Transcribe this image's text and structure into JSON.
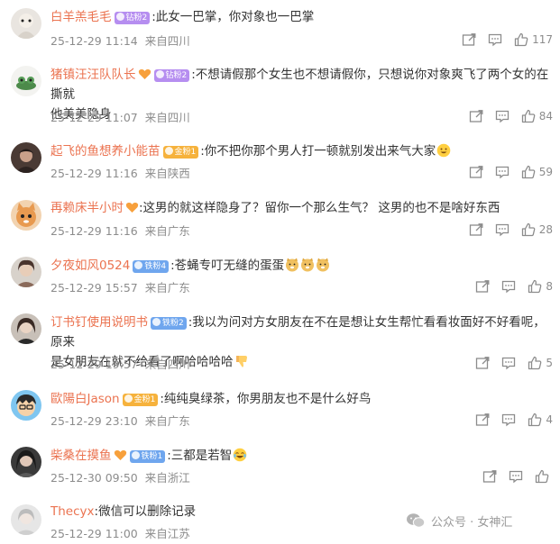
{
  "comments": [
    {
      "user": "白羊羔毛毛",
      "badge": "钻粉2",
      "text": ":此女一巴掌，你对象也一巴掌",
      "time": "25-12-29 11:14",
      "loc": "来自四川",
      "likes": "117"
    },
    {
      "user": "猪镇汪汪队队长",
      "badge": "钻粉2",
      "text": ":不想请假那个女生也不想请假你，只想说你对象爽飞了两个女的在撕就他美美隐身",
      "text1": ":不想请假那个女生也不想请假你，只想说你对象爽飞了两个女的在撕就",
      "text2": "他美美隐身",
      "time": "25-12-29 11:07",
      "loc": "来自四川",
      "likes": "84"
    },
    {
      "user": "起飞的鱼想养小能苗",
      "badge": "金粉1",
      "text": ":你不把你那个男人打一顿就别发出来气大家",
      "time": "25-12-29 11:16",
      "loc": "来自陕西",
      "likes": "59"
    },
    {
      "user": "再赖床半小时",
      "badge": "",
      "text": ":这男的就这样隐身了？留你一个那么生气？ 这男的也不是啥好东西",
      "time": "25-12-29 11:16",
      "loc": "来自广东",
      "likes": "28"
    },
    {
      "user": "夕夜如风0524",
      "badge": "铁粉4",
      "text": ":苍蝇专叮无缝的蛋蛋",
      "time": "25-12-29 15:57",
      "loc": "来自广东",
      "likes": "8"
    },
    {
      "user": "订书钉使用说明书",
      "badge": "铁粉2",
      "text": ":我以为问对方女朋友在不在是想让女生帮忙看看妆面好不好看呢，原来是女朋友在就不给看了啊哈哈哈哈",
      "text1": ":我以为问对方女朋友在不在是想让女生帮忙看看妆面好不好看呢，原来",
      "text2": "是女朋友在就不给看了啊哈哈哈哈",
      "time": "25-12-29 19:57",
      "loc": "来自四川",
      "likes": "5"
    },
    {
      "user": "歐陽白Jason",
      "badge": "金粉1",
      "text": ":纯纯臭绿茶，你男朋友也不是什么好鸟",
      "time": "25-12-29 23:10",
      "loc": "来自广东",
      "likes": "4"
    },
    {
      "user": "柴桑在摸鱼",
      "badge": "铁粉1",
      "text": ":三都是若智",
      "time": "25-12-30 09:50",
      "loc": "来自浙江",
      "likes": ""
    },
    {
      "user": "Thecyx",
      "badge": "",
      "text": ":微信可以删除记录",
      "time": "25-12-29 11:00",
      "loc": "来自江苏",
      "likes": ""
    }
  ],
  "watermark": "公众号 · 女神汇",
  "colors": {
    "username": "#eb7350",
    "text": "#333333",
    "meta": "#8c8c8c"
  }
}
